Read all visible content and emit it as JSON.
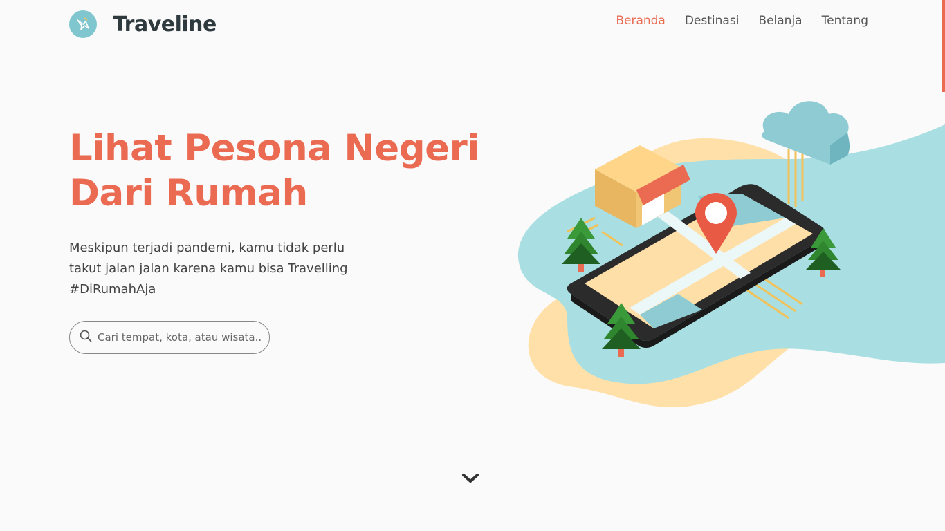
{
  "brand": {
    "name": "Traveline"
  },
  "nav": {
    "items": [
      "Beranda",
      "Destinasi",
      "Belanja",
      "Tentang"
    ],
    "active": "Beranda"
  },
  "hero": {
    "title_line1": "Lihat Pesona Negeri",
    "title_line2": "Dari Rumah",
    "description": "Meskipun terjadi pandemi, kamu tidak perlu takut jalan jalan karena kamu bisa Travelling #DiRumahAja"
  },
  "search": {
    "placeholder": "Cari tempat, kota, atau wisata..",
    "value": "",
    "icon": "search-icon"
  },
  "colors": {
    "accent": "#ea6a52",
    "teal": "#a9dfe2",
    "sand": "#ffe0a8",
    "background": "#fafafa"
  },
  "icons": {
    "logo": "origami-bird-icon",
    "scroll_down": "chevron-down-icon"
  }
}
